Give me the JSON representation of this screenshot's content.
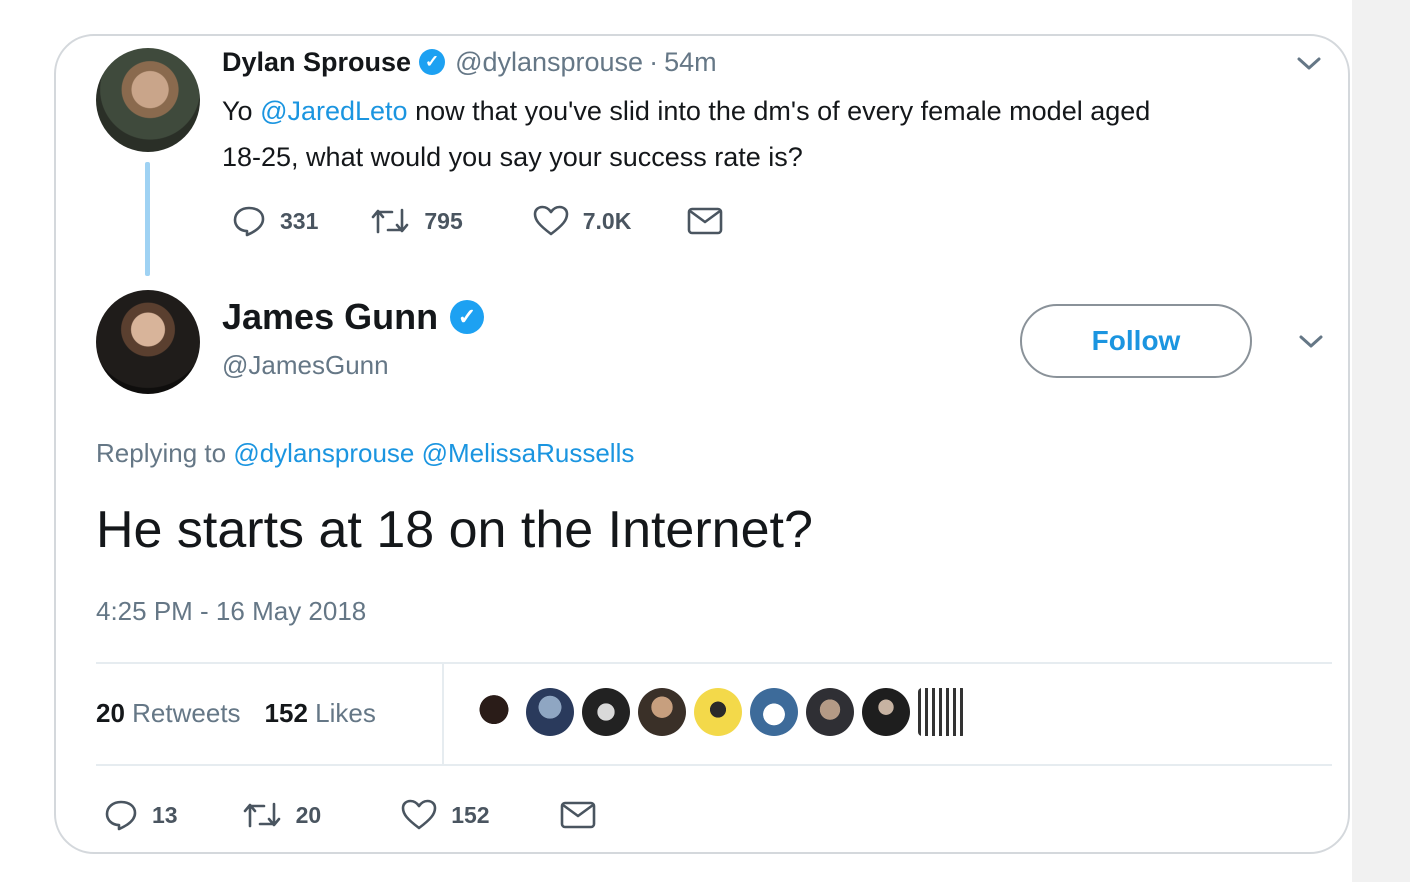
{
  "tweet1": {
    "name": "Dylan Sprouse",
    "handle": "@dylansprouse",
    "separator": "·",
    "time": "54m",
    "text_prefix": "Yo ",
    "mention": "@JaredLeto",
    "text_line1_rest": " now that you've slid into the dm's of every female model aged",
    "text_line2": "18-25, what would you say your success rate is?",
    "counts": {
      "replies": "331",
      "retweets": "795",
      "likes": "7.0K"
    }
  },
  "tweet2": {
    "name": "James Gunn",
    "handle": "@JamesGunn",
    "follow_label": "Follow",
    "replying_label": "Replying to ",
    "reply_mentions": "@dylansprouse @MelissaRussells",
    "text": "He starts at 18 on the Internet?",
    "timestamp": "4:25 PM - 16 May 2018",
    "retweet_count": "20",
    "retweet_label": "Retweets",
    "like_count": "152",
    "like_label": "Likes",
    "counts": {
      "replies": "13",
      "retweets": "20",
      "likes": "152"
    }
  },
  "colors": {
    "accent": "#1b95e0",
    "verified": "#1da1f2",
    "muted": "#657786",
    "thread_line": "#9fd2f3"
  },
  "icons": [
    "verified-badge-icon",
    "chevron-down-icon",
    "reply-icon",
    "retweet-icon",
    "heart-icon",
    "message-icon"
  ]
}
